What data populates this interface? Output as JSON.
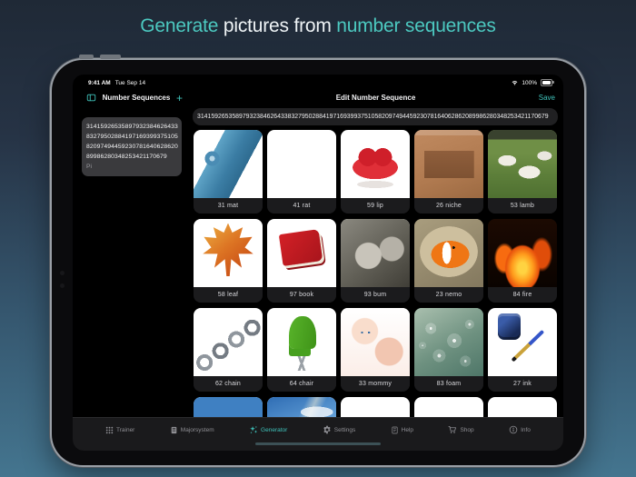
{
  "banner": {
    "parts": [
      {
        "text": "Generate"
      },
      {
        "text": " pictures from "
      },
      {
        "text": "number sequences"
      }
    ]
  },
  "status_bar": {
    "time": "9:41 AM",
    "date": "Tue Sep 14",
    "battery_percent": "100%"
  },
  "app": {
    "sidebar": {
      "title": "Number Sequences",
      "add_label": "+",
      "items": [
        {
          "sequence": "31415926535897932384626433832795028841971693993751058209749445923078164062862089986280348253421170679",
          "name": "Pi",
          "selected": true
        }
      ]
    },
    "detail": {
      "title": "Edit Number Sequence",
      "save_label": "Save",
      "sequence": "31415926535897932384626433832795028841971693993751058209749445923078164062862089986280348253421170679"
    },
    "grid": {
      "cells": [
        {
          "label": "31 mat",
          "image": "mat"
        },
        {
          "label": "41 rat",
          "image": "rat"
        },
        {
          "label": "59 lip",
          "image": "lip"
        },
        {
          "label": "26 niche",
          "image": "niche"
        },
        {
          "label": "53 lamb",
          "image": "lamb"
        },
        {
          "label": "58 leaf",
          "image": "leaf"
        },
        {
          "label": "97 book",
          "image": "book"
        },
        {
          "label": "93 bum",
          "image": "bum"
        },
        {
          "label": "23 nemo",
          "image": "nemo"
        },
        {
          "label": "84 fire",
          "image": "fire"
        },
        {
          "label": "62 chain",
          "image": "chain"
        },
        {
          "label": "64 chair",
          "image": "chair"
        },
        {
          "label": "33 mommy",
          "image": "mommy"
        },
        {
          "label": "83 foam",
          "image": "foam"
        },
        {
          "label": "27 ink",
          "image": "ink"
        },
        {
          "label": "",
          "image": "roof"
        },
        {
          "label": "",
          "image": "sky"
        },
        {
          "label": "",
          "image": "blank"
        },
        {
          "label": "",
          "image": "rat-partial"
        },
        {
          "label": "",
          "image": "book-partial"
        }
      ]
    },
    "tab_bar": {
      "items": [
        {
          "label": "Trainer",
          "icon": "trainer-grid-icon",
          "active": false
        },
        {
          "label": "Majorsystem",
          "icon": "majorsystem-book-icon",
          "active": false
        },
        {
          "label": "Generator",
          "icon": "generator-sparkle-icon",
          "active": true
        },
        {
          "label": "Settings",
          "icon": "settings-gear-icon",
          "active": false
        },
        {
          "label": "Help",
          "icon": "help-book-icon",
          "active": false
        },
        {
          "label": "Shop",
          "icon": "shop-cart-icon",
          "active": false
        },
        {
          "label": "Info",
          "icon": "info-icon",
          "active": false
        }
      ]
    }
  },
  "colors": {
    "accent_teal": "#3fc2ba",
    "banner_accent": "#4cc9c0",
    "page_bg_top": "#1f2936",
    "page_bg_bottom": "#44758f",
    "tab_inactive": "#8e8e93",
    "cell_label_bg": "#1b1b1d"
  }
}
